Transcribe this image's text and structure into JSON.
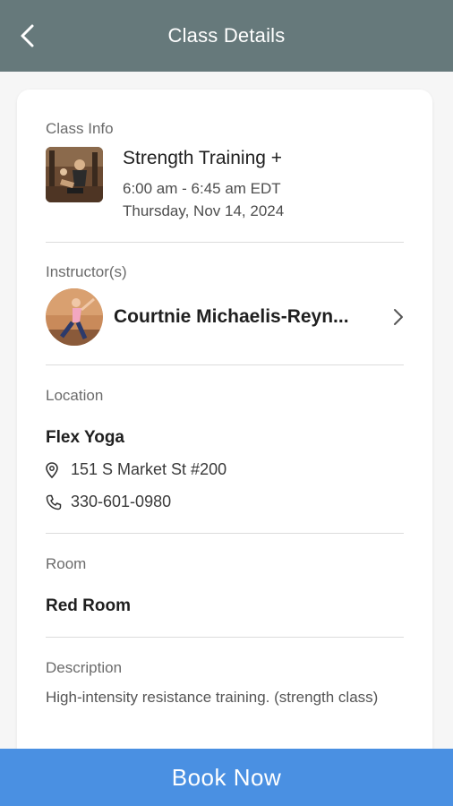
{
  "header": {
    "title": "Class Details",
    "back_icon": "chevron-left-icon"
  },
  "class_info": {
    "section_label": "Class Info",
    "name": "Strength Training +",
    "time": "6:00 am - 6:45 am EDT",
    "date": "Thursday, Nov 14, 2024"
  },
  "instructors": {
    "section_label": "Instructor(s)",
    "name": "Courtnie Michaelis-Reyn...",
    "chevron_icon": "chevron-right-icon"
  },
  "location": {
    "section_label": "Location",
    "name": "Flex Yoga",
    "address": "151 S Market St #200",
    "phone": "330-601-0980",
    "address_icon": "map-pin-icon",
    "phone_icon": "phone-icon"
  },
  "room": {
    "section_label": "Room",
    "name": "Red Room"
  },
  "description": {
    "section_label": "Description",
    "text": " High-intensity resistance training. (strength class)"
  },
  "actions": {
    "book_label": "Book Now"
  },
  "colors": {
    "header_bg": "#66797b",
    "button_bg": "#4a90e2",
    "page_bg": "#f6f6f6"
  }
}
